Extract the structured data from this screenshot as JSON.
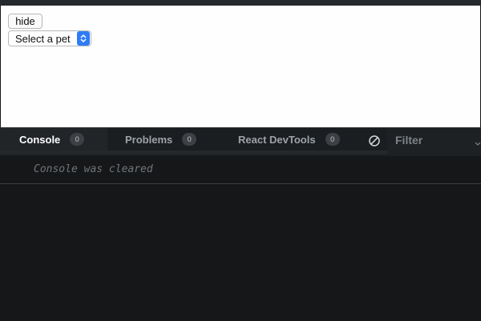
{
  "preview": {
    "hide_button_label": "hide",
    "pet_select": {
      "selected": "Select a pet"
    }
  },
  "devtools": {
    "tabs": [
      {
        "label": "Console",
        "count": "0",
        "active": true
      },
      {
        "label": "Problems",
        "count": "0",
        "active": false
      },
      {
        "label": "React DevTools",
        "count": "0",
        "active": false
      }
    ],
    "clear_icon": "clear-console-icon",
    "filter": {
      "placeholder": "Filter"
    },
    "console": {
      "message": "Console was cleared"
    }
  },
  "colors": {
    "panel_bg": "#151719",
    "select_accent": "#2f7cf6"
  }
}
